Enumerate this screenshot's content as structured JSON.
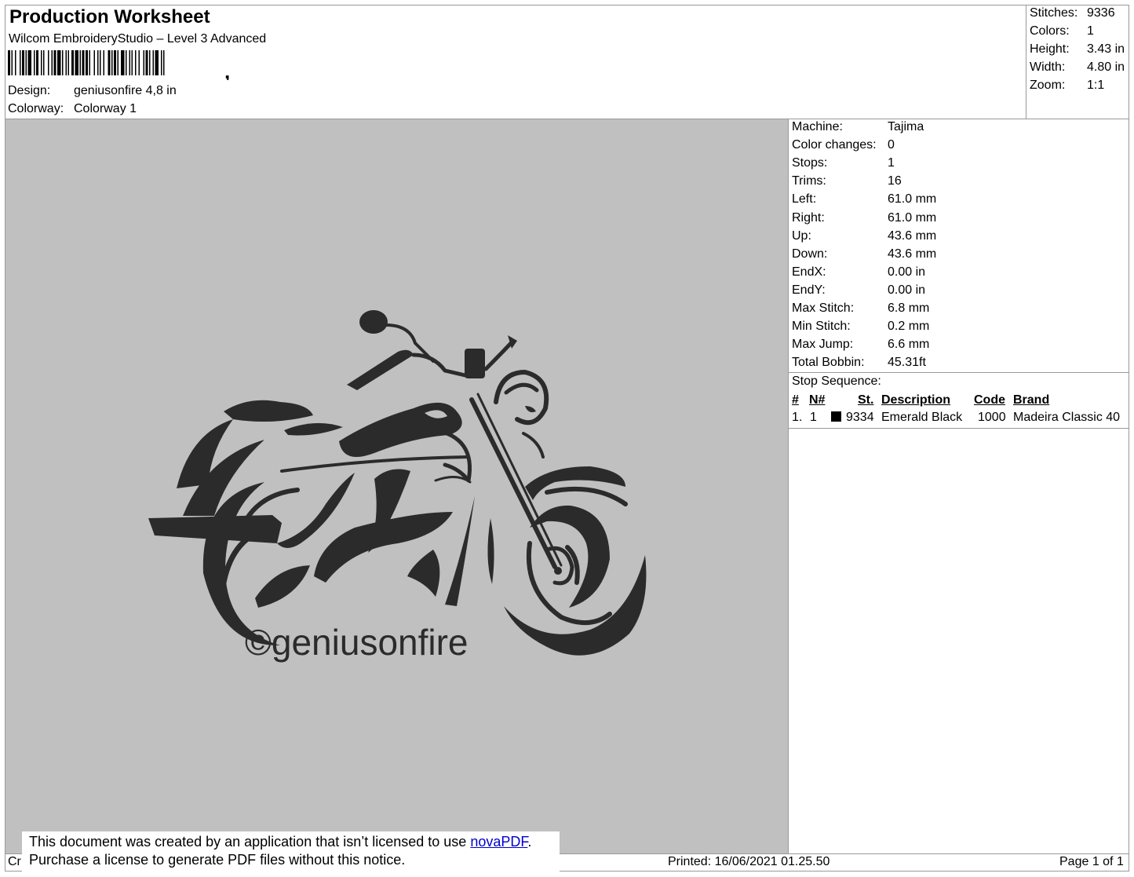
{
  "header": {
    "title": "Production Worksheet",
    "subtitle": "Wilcom EmbroideryStudio – Level 3 Advanced",
    "design_label": "Design:",
    "design_value": "geniusonfire 4,8 in",
    "colorway_label": "Colorway:",
    "colorway_value": "Colorway 1"
  },
  "summary": [
    {
      "label": "Stitches:",
      "value": "9336"
    },
    {
      "label": "Colors:",
      "value": "1"
    },
    {
      "label": "Height:",
      "value": "3.43 in"
    },
    {
      "label": "Width:",
      "value": "4.80 in"
    },
    {
      "label": "Zoom:",
      "value": "1:1"
    }
  ],
  "machine_info": [
    {
      "label": "Machine:",
      "value": "Tajima"
    },
    {
      "label": "Color changes:",
      "value": "0"
    },
    {
      "label": "Stops:",
      "value": "1"
    },
    {
      "label": "Trims:",
      "value": "16"
    },
    {
      "label": "Left:",
      "value": "61.0 mm"
    },
    {
      "label": "Right:",
      "value": "61.0 mm"
    },
    {
      "label": "Up:",
      "value": "43.6 mm"
    },
    {
      "label": "Down:",
      "value": "43.6 mm"
    },
    {
      "label": "EndX:",
      "value": "0.00 in"
    },
    {
      "label": "EndY:",
      "value": "0.00 in"
    },
    {
      "label": "Max Stitch:",
      "value": "6.8 mm"
    },
    {
      "label": "Min Stitch:",
      "value": "0.2 mm"
    },
    {
      "label": "Max Jump:",
      "value": "6.6 mm"
    },
    {
      "label": "Total Bobbin:",
      "value": "45.31ft"
    }
  ],
  "stop_sequence": {
    "title": "Stop Sequence:",
    "headers": {
      "num": "#",
      "n": "N#",
      "st": "St.",
      "description": "Description",
      "code": "Code",
      "brand": "Brand"
    },
    "rows": [
      {
        "num": "1.",
        "n": "1",
        "swatch_color": "#000000",
        "st": "9334",
        "description": "Emerald Black",
        "code": "1000",
        "brand": "Madeira Classic 40"
      }
    ]
  },
  "design_preview": {
    "caption": "©geniusonfire",
    "thread_color": "#2b2b2b",
    "background": "#c0c0c0"
  },
  "footer": {
    "left_fragment": "Cr",
    "printed": "Printed: 16/06/2021 01.25.50",
    "page": "Page 1 of 1"
  },
  "notice": {
    "line1_before": "This document was created by an application that isn’t licensed to use ",
    "link": "novaPDF",
    "line1_after": ".",
    "line2": "Purchase a license to generate PDF files without this notice."
  }
}
